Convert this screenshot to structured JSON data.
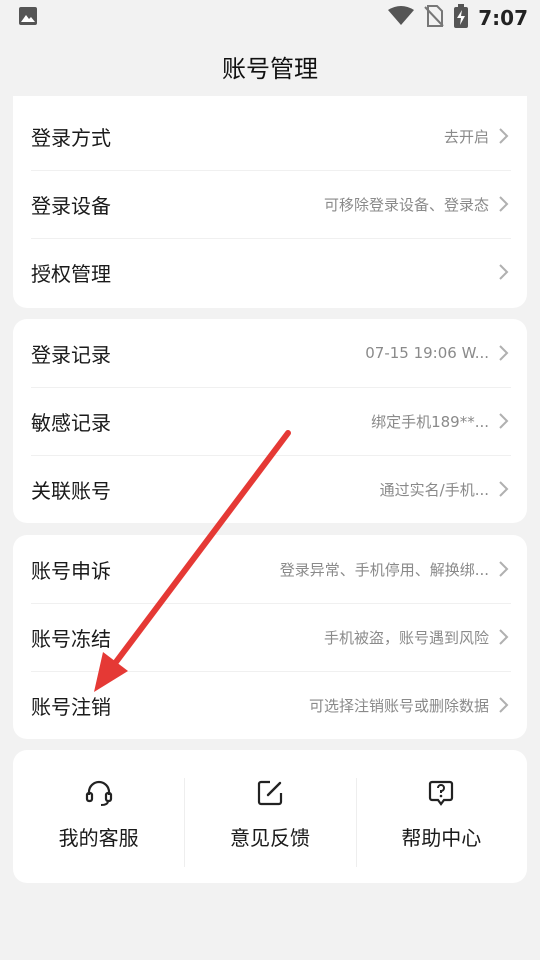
{
  "status_bar": {
    "time": "7:07",
    "icons": [
      "image-icon",
      "wifi-icon",
      "no-sim-icon",
      "battery-charging-icon"
    ]
  },
  "header": {
    "title": "账号管理"
  },
  "groups": [
    {
      "items": [
        {
          "label": "登录方式",
          "value": "去开启"
        },
        {
          "label": "登录设备",
          "value": "可移除登录设备、登录态"
        },
        {
          "label": "授权管理",
          "value": ""
        }
      ]
    },
    {
      "items": [
        {
          "label": "登录记录",
          "value": "07-15 19:06 W..."
        },
        {
          "label": "敏感记录",
          "value": "绑定手机189**..."
        },
        {
          "label": "关联账号",
          "value": "通过实名/手机..."
        }
      ]
    },
    {
      "items": [
        {
          "label": "账号申诉",
          "value": "登录异常、手机停用、解换绑..."
        },
        {
          "label": "账号冻结",
          "value": "手机被盗，账号遇到风险"
        },
        {
          "label": "账号注销",
          "value": "可选择注销账号或删除数据"
        }
      ]
    }
  ],
  "tools": [
    {
      "label": "我的客服",
      "icon": "headset-icon"
    },
    {
      "label": "意见反馈",
      "icon": "edit-feedback-icon"
    },
    {
      "label": "帮助中心",
      "icon": "help-icon"
    }
  ],
  "colors": {
    "annotation_arrow": "#e53935",
    "background": "#f2f2f2",
    "secondary_text": "#8a8a8a"
  }
}
